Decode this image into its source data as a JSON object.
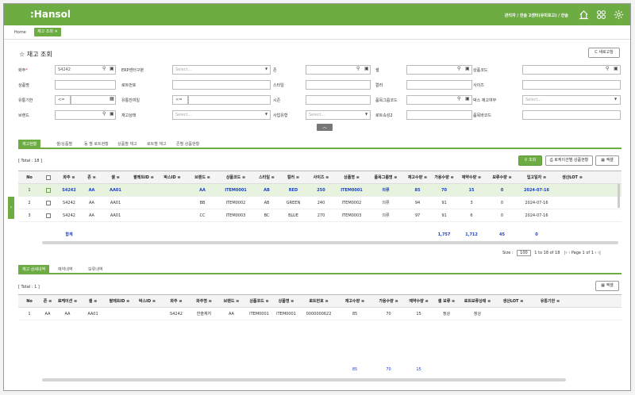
{
  "app": {
    "logo": ":Hansol",
    "user_info": "관리자 / 한솔 2센터(유미포고) / 한솔"
  },
  "tabs": {
    "home": "Home",
    "active": "재고 조회 ✕"
  },
  "page": {
    "title": "☆ 재고 조회",
    "refresh_label": "C 새로고침"
  },
  "filters": {
    "owner_label": "화주",
    "owner_value": "S4242",
    "erp_center_label": "ERP센터구분",
    "erp_center_ph": "Select...",
    "zone_label": "존",
    "cell_label": "셀",
    "product_code_label": "상품코드",
    "product_name_label": "상품명",
    "lot_label": "로트번호",
    "style_label": "스타일",
    "color_label": "컬러",
    "size_label": "사이즈",
    "expiry_label": "유통기한",
    "expiry_op": "<=",
    "expiry_remain_label": "유통잔여일",
    "expiry_remain_op": "<=",
    "season_label": "시즌",
    "group_code_label": "품목그룹코드",
    "box_stock_label": "박스 재고여부",
    "box_stock_ph": "Select...",
    "brand_label": "브랜드",
    "stock_status_label": "재고상태",
    "stock_status_ph": "Select...",
    "biz_type_label": "사업유형",
    "biz_type_ph": "Select...",
    "lot_attr2_label": "로트속성2",
    "barcode_label": "품목바코드"
  },
  "main_tabs": [
    "재고현황",
    "셀/상품별",
    "동 별 로트현황",
    "상품별 재고",
    "로트별 재고",
    "존별 상품현황"
  ],
  "grid1": {
    "total": "[ Total : 18 ]",
    "search_label": "조회",
    "location_btn": "로케이션별 상품현황",
    "excel_btn": "엑셀",
    "columns": [
      "No",
      "",
      "화주 ≡",
      "존 ≡",
      "셀 ≡",
      "팔레트ID ≡",
      "박스ID ≡",
      "브랜드 ≡",
      "상품코드 ≡",
      "스타일 ≡",
      "컬러 ≡",
      "사이즈 ≡",
      "상품명 ≡",
      "품목그룹명 ≡",
      "재고수량 ≡",
      "가용수량 ≡",
      "예약수량 ≡",
      "보류수량 ≡",
      "입고일자 ≡",
      "생산LOT ≡"
    ],
    "rows": [
      [
        "1",
        "S4242",
        "AA",
        "AA01",
        "",
        "",
        "AA",
        "ITEM0001",
        "AB",
        "RED",
        "250",
        "ITEM0001",
        "의류",
        "85",
        "70",
        "15",
        "0",
        "2024-07-16",
        ""
      ],
      [
        "2",
        "S4242",
        "AA",
        "AA01",
        "",
        "",
        "BB",
        "ITEM0002",
        "AB",
        "GREEN",
        "240",
        "ITEM0002",
        "의류",
        "94",
        "91",
        "3",
        "0",
        "2024-07-16",
        ""
      ],
      [
        "3",
        "S4242",
        "AA",
        "AA01",
        "",
        "",
        "CC",
        "ITEM0003",
        "BC",
        "BLUE",
        "270",
        "ITEM0003",
        "의류",
        "97",
        "91",
        "6",
        "0",
        "2024-07-16",
        ""
      ]
    ],
    "sum_label": "합계",
    "sums": {
      "stock": "1,757",
      "avail": "1,712",
      "reserved": "45",
      "hold": "0"
    },
    "pager": {
      "size_label": "Size :",
      "size": "100",
      "range": "1 to 18 of 18",
      "page": "Page 1 of 1"
    }
  },
  "detail_tabs": [
    "재고 상세내역",
    "예약내역",
    "보류내역"
  ],
  "grid2": {
    "total": "[ Total : 1 ]",
    "excel_btn": "엑셀",
    "columns": [
      "No",
      "존 ≡",
      "로케이션 ≡",
      "셀 ≡",
      "팔레트ID ≡",
      "박스ID ≡",
      "화주 ≡",
      "화주명 ≡",
      "브랜드 ≡",
      "상품코드 ≡",
      "상품명 ≡",
      "로트번호 ≡",
      "재고수량 ≡",
      "가용수량 ≡",
      "예약수량 ≡",
      "셀 보류 ≡",
      "로트보류상태 ≡",
      "생산LOT ≡",
      "유통기한 ≡"
    ],
    "rows": [
      [
        "1",
        "AA",
        "AA",
        "AA01",
        "",
        "",
        "S4242",
        "한솔제지",
        "AA",
        "ITEM0001",
        "ITEM0001",
        "0000000622",
        "85",
        "70",
        "15",
        "정상",
        "정상",
        "",
        ""
      ]
    ],
    "sums": {
      "stock": "85",
      "avail": "70",
      "reserved": "15"
    }
  },
  "colors": {
    "accent": "#6dab43",
    "link_blue": "#1a3fc4"
  }
}
